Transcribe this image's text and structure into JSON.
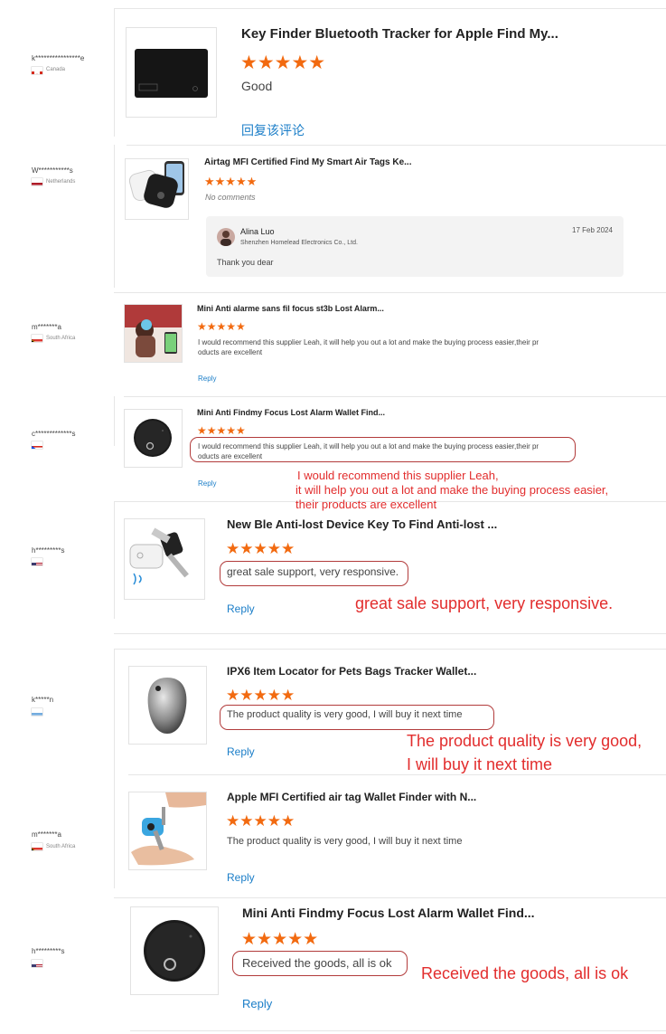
{
  "reviews": [
    {
      "buyer": "k****************e",
      "country": "Canada",
      "title": "Key Finder Bluetooth Tracker for Apple Find My...",
      "stars": 5,
      "text": "Good",
      "reply_label": "回复该评论"
    },
    {
      "buyer": "W***********s",
      "country": "Netherlands",
      "title": "Airtag MFI Certified Find My Smart Air Tags Ke...",
      "stars": 5,
      "text": "No comments",
      "seller_reply": {
        "name": "Alina Luo",
        "company": "Shenzhen Homelead Electronics Co., Ltd.",
        "date": "17 Feb 2024",
        "text": "Thank you dear"
      }
    },
    {
      "buyer": "m*******a",
      "country": "South Africa",
      "title": "Mini Anti alarme sans fil focus st3b Lost Alarm...",
      "stars": 5,
      "text_line1": "I would recommend this supplier Leah, it will help you out a lot and make the buying process easier,their pr",
      "text_line2": "oducts are excellent",
      "reply_label": "Reply"
    },
    {
      "buyer": "c*************s",
      "country": "",
      "title": "Mini Anti Findmy Focus Lost Alarm Wallet Find...",
      "stars": 5,
      "text_line1": "I would recommend this supplier Leah, it will help you out a lot and make the buying process easier,their pr",
      "text_line2": "oducts are excellent",
      "reply_label": "Reply",
      "annotation": [
        "I would recommend this supplier Leah,",
        "it will help you out a lot and make the buying process easier,",
        "their products are excellent"
      ]
    },
    {
      "buyer": "h*********s",
      "country": "",
      "title": "New Ble Anti-lost Device Key To Find Anti-lost ...",
      "stars": 5,
      "text": "great sale support, very responsive.",
      "reply_label": "Reply",
      "annotation": "great sale support, very responsive."
    },
    {
      "buyer": "k*****n",
      "country": "",
      "title": "IPX6 Item Locator for Pets Bags Tracker Wallet...",
      "stars": 5,
      "text": "The product quality is very good, I will buy it next time",
      "reply_label": "Reply",
      "annotation": [
        "The product quality is very good,",
        "I will buy it next time"
      ]
    },
    {
      "buyer": "m*******a",
      "country": "South Africa",
      "title": "Apple MFI Certified air tag Wallet Finder with N...",
      "stars": 5,
      "text": "The product quality is very good, I will buy it next time",
      "reply_label": "Reply"
    },
    {
      "buyer": "h*********s",
      "country": "",
      "title": "Mini Anti Findmy Focus Lost Alarm Wallet Find...",
      "stars": 5,
      "text": "Received the goods, all is ok",
      "reply_label": "Reply",
      "annotation": "Received the goods, all is ok"
    }
  ],
  "star_glyphs": "★★★★★",
  "colors": {
    "star": "#f26a10",
    "link": "#1b7ec8",
    "annotation": "#e22d2d",
    "oval": "#b23b3b"
  }
}
